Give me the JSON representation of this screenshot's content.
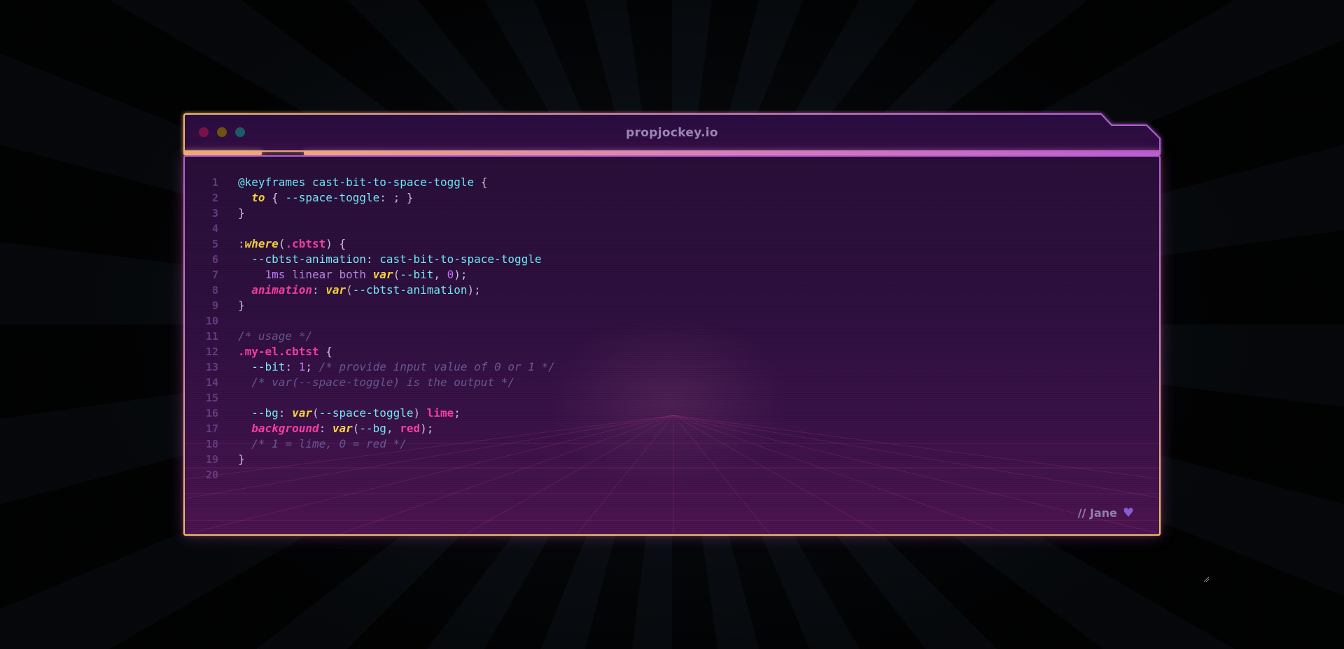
{
  "window": {
    "title": "propjockey.io"
  },
  "colors": {
    "accent_pink": "#ff3fa9",
    "accent_cyan": "#6ff0ff",
    "accent_yellow": "#ffd93d",
    "frame_purple": "#b45cd6",
    "frame_gold": "#f2c16a"
  },
  "editor": {
    "lines": [
      {
        "n": "1",
        "tokens": [
          {
            "c": "t-atrule",
            "t": "@keyframes"
          },
          {
            "c": "t-punc",
            "t": " "
          },
          {
            "c": "t-name",
            "t": "cast-bit-to-space-toggle"
          },
          {
            "c": "t-punc",
            "t": " {"
          }
        ]
      },
      {
        "n": "2",
        "tokens": [
          {
            "c": "t-punc",
            "t": "  "
          },
          {
            "c": "t-kw",
            "t": "to"
          },
          {
            "c": "t-punc",
            "t": " { "
          },
          {
            "c": "t-prop",
            "t": "--space-toggle"
          },
          {
            "c": "t-punc",
            "t": ": ; }"
          }
        ]
      },
      {
        "n": "3",
        "tokens": [
          {
            "c": "t-punc",
            "t": "}"
          }
        ]
      },
      {
        "n": "4",
        "tokens": []
      },
      {
        "n": "5",
        "tokens": [
          {
            "c": "t-punc",
            "t": ":"
          },
          {
            "c": "t-kw",
            "t": "where"
          },
          {
            "c": "t-punc",
            "t": "("
          },
          {
            "c": "t-class",
            "t": ".cbtst"
          },
          {
            "c": "t-punc",
            "t": ") {"
          }
        ]
      },
      {
        "n": "6",
        "tokens": [
          {
            "c": "t-punc",
            "t": "  "
          },
          {
            "c": "t-prop",
            "t": "--cbtst-animation"
          },
          {
            "c": "t-punc",
            "t": ": "
          },
          {
            "c": "t-name",
            "t": "cast-bit-to-space-toggle"
          }
        ]
      },
      {
        "n": "7",
        "tokens": [
          {
            "c": "t-punc",
            "t": "    "
          },
          {
            "c": "t-num",
            "t": "1ms"
          },
          {
            "c": "t-plain",
            "t": " linear both "
          },
          {
            "c": "t-fn",
            "t": "var"
          },
          {
            "c": "t-punc",
            "t": "("
          },
          {
            "c": "t-prop",
            "t": "--bit"
          },
          {
            "c": "t-punc",
            "t": ", "
          },
          {
            "c": "t-num",
            "t": "0"
          },
          {
            "c": "t-punc",
            "t": ");"
          }
        ]
      },
      {
        "n": "8",
        "tokens": [
          {
            "c": "t-punc",
            "t": "  "
          },
          {
            "c": "t-prop2",
            "t": "animation"
          },
          {
            "c": "t-punc",
            "t": ": "
          },
          {
            "c": "t-fn",
            "t": "var"
          },
          {
            "c": "t-punc",
            "t": "("
          },
          {
            "c": "t-prop",
            "t": "--cbtst-animation"
          },
          {
            "c": "t-punc",
            "t": ");"
          }
        ]
      },
      {
        "n": "9",
        "tokens": [
          {
            "c": "t-punc",
            "t": "}"
          }
        ]
      },
      {
        "n": "10",
        "tokens": []
      },
      {
        "n": "11",
        "tokens": [
          {
            "c": "t-comment",
            "t": "/* usage */"
          }
        ]
      },
      {
        "n": "12",
        "tokens": [
          {
            "c": "t-class",
            "t": ".my-el.cbtst"
          },
          {
            "c": "t-punc",
            "t": " {"
          }
        ]
      },
      {
        "n": "13",
        "tokens": [
          {
            "c": "t-punc",
            "t": "  "
          },
          {
            "c": "t-prop",
            "t": "--bit"
          },
          {
            "c": "t-punc",
            "t": ": "
          },
          {
            "c": "t-num",
            "t": "1"
          },
          {
            "c": "t-punc",
            "t": "; "
          },
          {
            "c": "t-comment",
            "t": "/* provide input value of 0 or 1 */"
          }
        ]
      },
      {
        "n": "14",
        "tokens": [
          {
            "c": "t-punc",
            "t": "  "
          },
          {
            "c": "t-comment",
            "t": "/* var(--space-toggle) is the output */"
          }
        ]
      },
      {
        "n": "15",
        "tokens": []
      },
      {
        "n": "16",
        "tokens": [
          {
            "c": "t-punc",
            "t": "  "
          },
          {
            "c": "t-prop",
            "t": "--bg"
          },
          {
            "c": "t-punc",
            "t": ": "
          },
          {
            "c": "t-fn",
            "t": "var"
          },
          {
            "c": "t-punc",
            "t": "("
          },
          {
            "c": "t-prop",
            "t": "--space-toggle"
          },
          {
            "c": "t-punc",
            "t": ") "
          },
          {
            "c": "t-color",
            "t": "lime"
          },
          {
            "c": "t-punc",
            "t": ";"
          }
        ]
      },
      {
        "n": "17",
        "tokens": [
          {
            "c": "t-punc",
            "t": "  "
          },
          {
            "c": "t-prop2",
            "t": "background"
          },
          {
            "c": "t-punc",
            "t": ": "
          },
          {
            "c": "t-fn",
            "t": "var"
          },
          {
            "c": "t-punc",
            "t": "("
          },
          {
            "c": "t-prop",
            "t": "--bg"
          },
          {
            "c": "t-punc",
            "t": ", "
          },
          {
            "c": "t-color",
            "t": "red"
          },
          {
            "c": "t-punc",
            "t": ");"
          }
        ]
      },
      {
        "n": "18",
        "tokens": [
          {
            "c": "t-punc",
            "t": "  "
          },
          {
            "c": "t-comment",
            "t": "/* 1 = lime, 0 = red */"
          }
        ]
      },
      {
        "n": "19",
        "tokens": [
          {
            "c": "t-punc",
            "t": "}"
          }
        ]
      },
      {
        "n": "20",
        "tokens": []
      }
    ]
  },
  "signature": {
    "text": "// Jane",
    "icon": "heart-icon"
  }
}
